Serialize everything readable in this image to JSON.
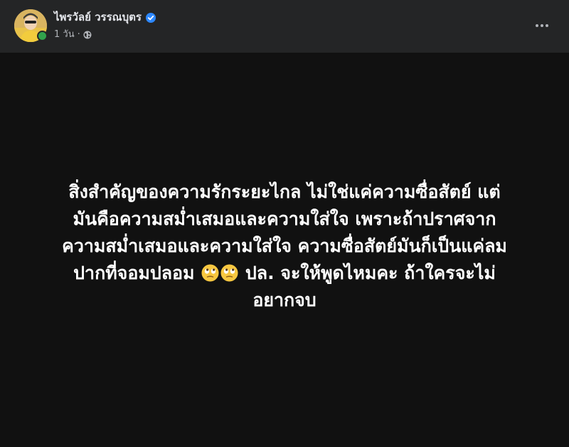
{
  "author": {
    "name": "ไพรวัลย์ วรรณบุตร",
    "verified": true,
    "online": true
  },
  "meta": {
    "time": "1 วัน",
    "separator": "·",
    "privacy_icon": "globe-icon"
  },
  "post": {
    "text_part1": "สิ่งสำคัญของความรักระยะไกล ไม่ใช่แค่ความซื่อสัตย์ แต่\nมันคือความสม่ำเสมอและความใส่ใจ เพราะถ้าปราศจาก\nความสม่ำเสมอและความใส่ใจ ความซื่อสัตย์มันก็เป็นแค่ลม\nปากที่จอมปลอม ",
    "emojis": [
      "eye-roll-emoji",
      "eye-roll-emoji"
    ],
    "text_part2": " ปล. จะให้พูดไหมคะ ถ้าใครจะไม่\nอยากจบ"
  },
  "colors": {
    "header_bg": "#242526",
    "content_bg": "#111111",
    "text_primary": "#e4e6eb",
    "text_secondary": "#b0b3b8",
    "verified_blue": "#2d88ff",
    "online_green": "#31a24c"
  }
}
